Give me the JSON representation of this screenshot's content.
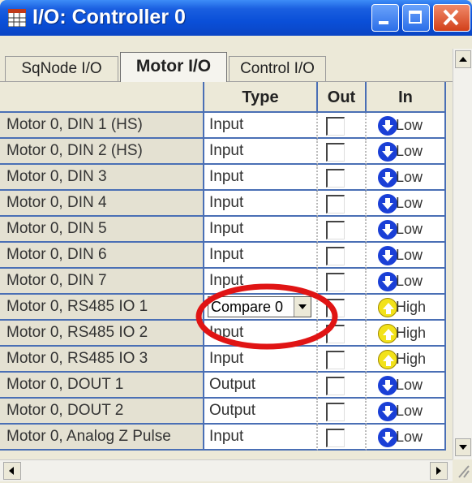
{
  "window": {
    "title": "I/O: Controller 0",
    "titlebar_color": "#0a4fd8",
    "close_color": "#d2401a"
  },
  "tabs": [
    {
      "label": "SqNode I/O",
      "active": false
    },
    {
      "label": "Motor I/O",
      "active": true
    },
    {
      "label": "Control I/O",
      "active": false
    }
  ],
  "columns": {
    "name": "",
    "type": "Type",
    "out": "Out",
    "in": "In"
  },
  "rows": [
    {
      "name": "Motor 0, DIN 1 (HS)",
      "type": "Input",
      "out_checked": false,
      "in": "Low"
    },
    {
      "name": "Motor 0, DIN 2 (HS)",
      "type": "Input",
      "out_checked": false,
      "in": "Low"
    },
    {
      "name": "Motor 0, DIN 3",
      "type": "Input",
      "out_checked": false,
      "in": "Low"
    },
    {
      "name": "Motor 0, DIN 4",
      "type": "Input",
      "out_checked": false,
      "in": "Low"
    },
    {
      "name": "Motor 0, DIN 5",
      "type": "Input",
      "out_checked": false,
      "in": "Low"
    },
    {
      "name": "Motor 0, DIN 6",
      "type": "Input",
      "out_checked": false,
      "in": "Low"
    },
    {
      "name": "Motor 0, DIN 7",
      "type": "Input",
      "out_checked": false,
      "in": "Low"
    },
    {
      "name": "Motor 0, RS485 IO 1",
      "type": "Compare 0",
      "type_is_dropdown": true,
      "out_checked": false,
      "in": "High"
    },
    {
      "name": "Motor 0, RS485 IO 2",
      "type": "Input",
      "out_checked": false,
      "in": "High"
    },
    {
      "name": "Motor 0, RS485 IO 3",
      "type": "Input",
      "out_checked": false,
      "in": "High"
    },
    {
      "name": "Motor 0, DOUT 1",
      "type": "Output",
      "out_checked": false,
      "in": "Low"
    },
    {
      "name": "Motor 0, DOUT 2",
      "type": "Output",
      "out_checked": false,
      "in": "Low"
    },
    {
      "name": "Motor 0, Analog Z Pulse",
      "type": "Input",
      "out_checked": false,
      "in": "Low"
    }
  ],
  "colors": {
    "low_arrow": "#1a3fd6",
    "high_arrow": "#f2e21a",
    "highlight_ellipse": "#e01414",
    "grid_line": "#4a6fb5"
  },
  "icons": {
    "window": "io-grid-icon",
    "low": "arrow-down-circle-icon",
    "high": "arrow-up-circle-icon"
  }
}
